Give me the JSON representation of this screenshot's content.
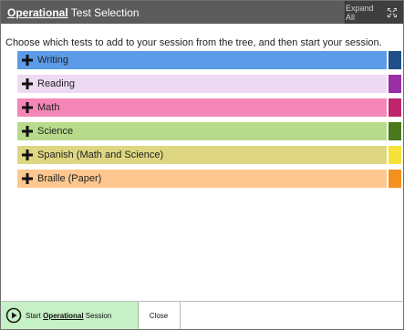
{
  "header": {
    "title_bold": "Operational",
    "title_rest": " Test Selection",
    "expand_label": "Expand All"
  },
  "instructions": "Choose which tests to add to your session from the tree, and then start your session.",
  "tests": [
    {
      "label": "Writing",
      "bar_color": "#5c9be8",
      "accent_color": "#1f4e8a"
    },
    {
      "label": "Reading",
      "bar_color": "#eddaf2",
      "accent_color": "#9a2ea6"
    },
    {
      "label": "Math",
      "bar_color": "#f487b8",
      "accent_color": "#c0246c"
    },
    {
      "label": "Science",
      "bar_color": "#b7db8a",
      "accent_color": "#4a7a1b"
    },
    {
      "label": "Spanish (Math and Science)",
      "bar_color": "#dfd682",
      "accent_color": "#f7e23c"
    },
    {
      "label": "Braille (Paper)",
      "bar_color": "#fdc78f",
      "accent_color": "#f5901e"
    }
  ],
  "footer": {
    "start_prefix": "Start ",
    "start_bold": "Operational",
    "start_suffix": " Session",
    "close_label": "Close"
  }
}
